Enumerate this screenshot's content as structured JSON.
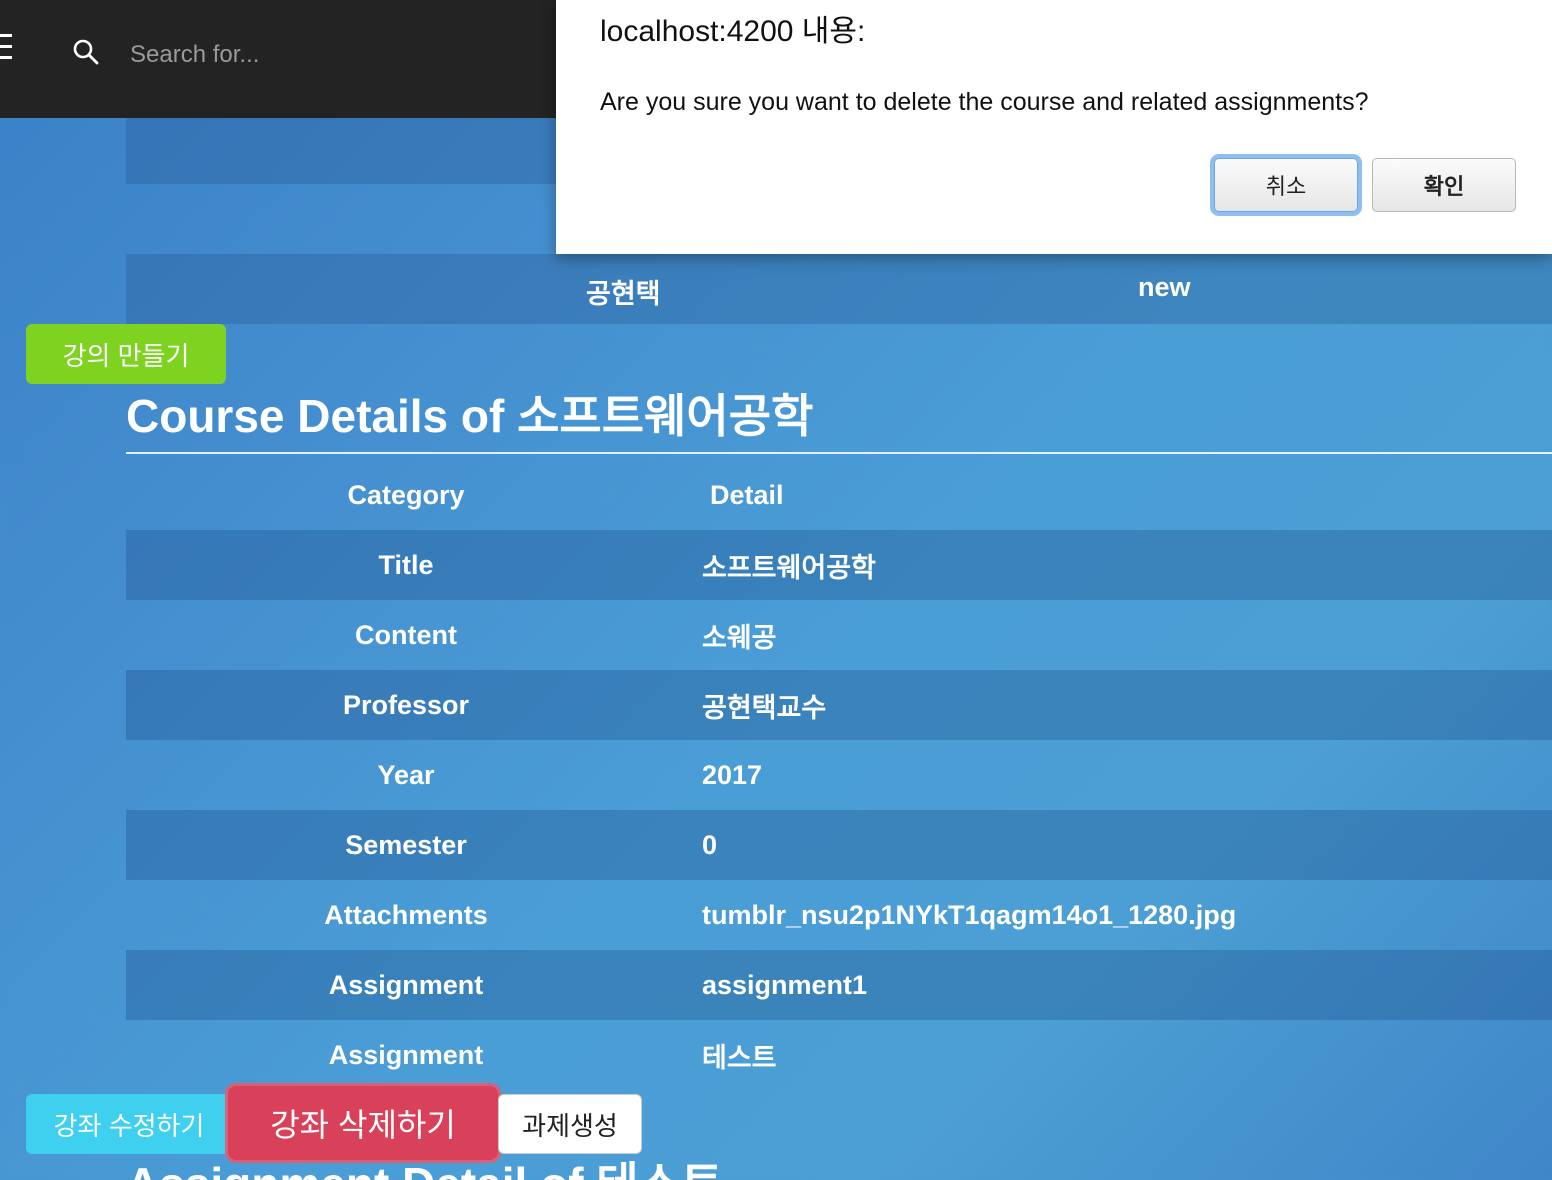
{
  "topbar": {
    "search_placeholder": "Search for..."
  },
  "upper_table": {
    "row": {
      "col1": "공현택",
      "col2": "new"
    }
  },
  "create_course_label": "강의 만들기",
  "course": {
    "heading": "Course Details of 소프트웨어공학",
    "columns": {
      "category": "Category",
      "detail": "Detail"
    },
    "rows": [
      {
        "category": "Title",
        "detail": "소프트웨어공학"
      },
      {
        "category": "Content",
        "detail": "소웨공"
      },
      {
        "category": "Professor",
        "detail": "공현택교수"
      },
      {
        "category": "Year",
        "detail": "2017"
      },
      {
        "category": "Semester",
        "detail": "0"
      },
      {
        "category": "Attachments",
        "detail": "tumblr_nsu2p1NYkT1qagm14o1_1280.jpg"
      },
      {
        "category": "Assignment",
        "detail": "assignment1"
      },
      {
        "category": "Assignment",
        "detail": "테스트"
      }
    ]
  },
  "actions": {
    "edit_label": "강좌 수정하기",
    "delete_label": "강좌 삭제하기",
    "create_assignment_label": "과제생성"
  },
  "assignment_heading": "Assignment Detail of 테스트",
  "dialog": {
    "origin": "localhost:4200 내용:",
    "message": "Are you sure you want to delete the course and related assignments?",
    "cancel_label": "취소",
    "ok_label": "확인"
  }
}
